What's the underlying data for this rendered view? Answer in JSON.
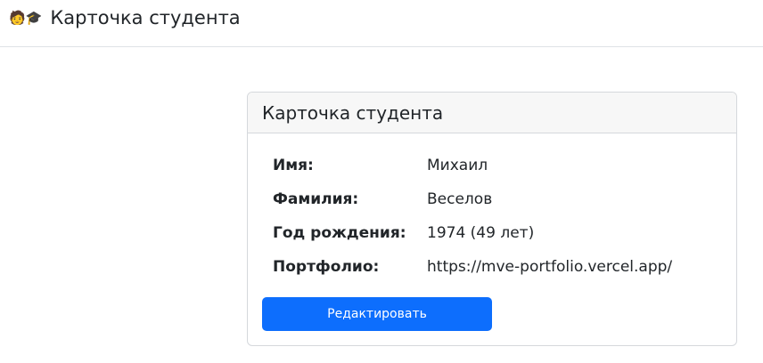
{
  "header": {
    "icon_student": "🧑",
    "icon_cap": "🎓",
    "title": "Карточка студента"
  },
  "card": {
    "title": "Карточка студента",
    "fields": [
      {
        "label": "Имя:",
        "value": "Михаил"
      },
      {
        "label": "Фамилия:",
        "value": "Веселов"
      },
      {
        "label": "Год рождения:",
        "value": "1974 (49 лет)"
      },
      {
        "label": "Портфолио:",
        "value": "https://mve-portfolio.vercel.app/"
      }
    ],
    "edit_button": "Редактировать"
  },
  "colors": {
    "primary": "#0d6efd",
    "card_header_bg": "#f7f7f7",
    "border": "#d5d8dc"
  }
}
